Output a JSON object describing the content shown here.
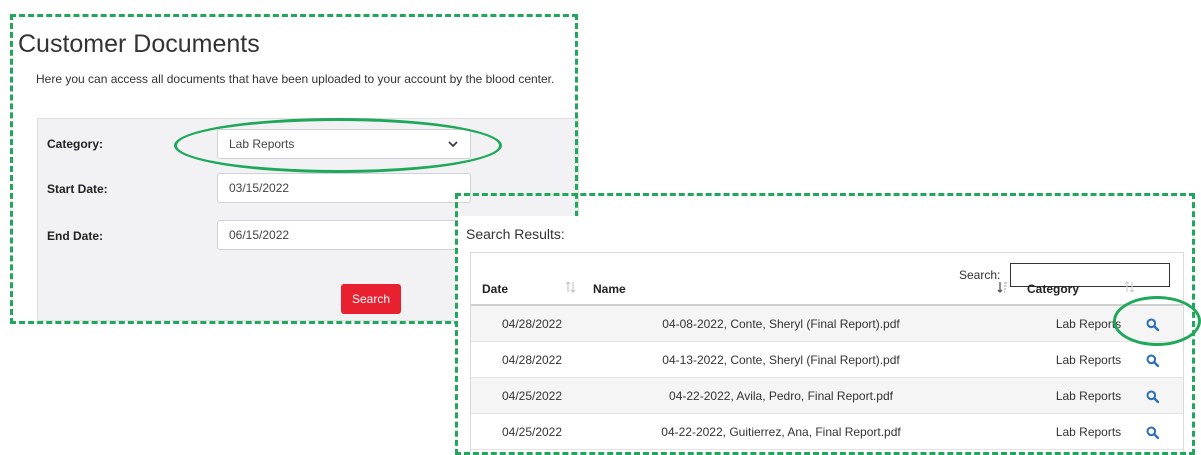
{
  "page": {
    "title": "Customer Documents",
    "intro": "Here you can access all documents that have been uploaded to your account by the blood center."
  },
  "form": {
    "category_label": "Category:",
    "category_value": "Lab Reports",
    "start_label": "Start Date:",
    "start_value": "03/15/2022",
    "end_label": "End Date:",
    "end_value": "06/15/2022",
    "search_button": "Search"
  },
  "results": {
    "title": "Search Results:",
    "search_label": "Search:",
    "search_value": "",
    "columns": {
      "date": "Date",
      "name": "Name",
      "category": "Category"
    },
    "rows": [
      {
        "date": "04/28/2022",
        "name": "04-08-2022, Conte, Sheryl (Final Report).pdf",
        "category": "Lab Reports"
      },
      {
        "date": "04/28/2022",
        "name": "04-13-2022, Conte, Sheryl (Final Report).pdf",
        "category": "Lab Reports"
      },
      {
        "date": "04/25/2022",
        "name": "04-22-2022, Avila, Pedro, Final Report.pdf",
        "category": "Lab Reports"
      },
      {
        "date": "04/25/2022",
        "name": "04-22-2022, Guitierrez, Ana, Final Report.pdf",
        "category": "Lab Reports"
      }
    ]
  },
  "icons": {
    "view": "magnifier-icon",
    "select": "chevron-down-icon",
    "sort": "sort-icon"
  },
  "colors": {
    "highlight": "#1fa85a",
    "button": "#e8202f",
    "link_icon": "#2c6fb7"
  }
}
